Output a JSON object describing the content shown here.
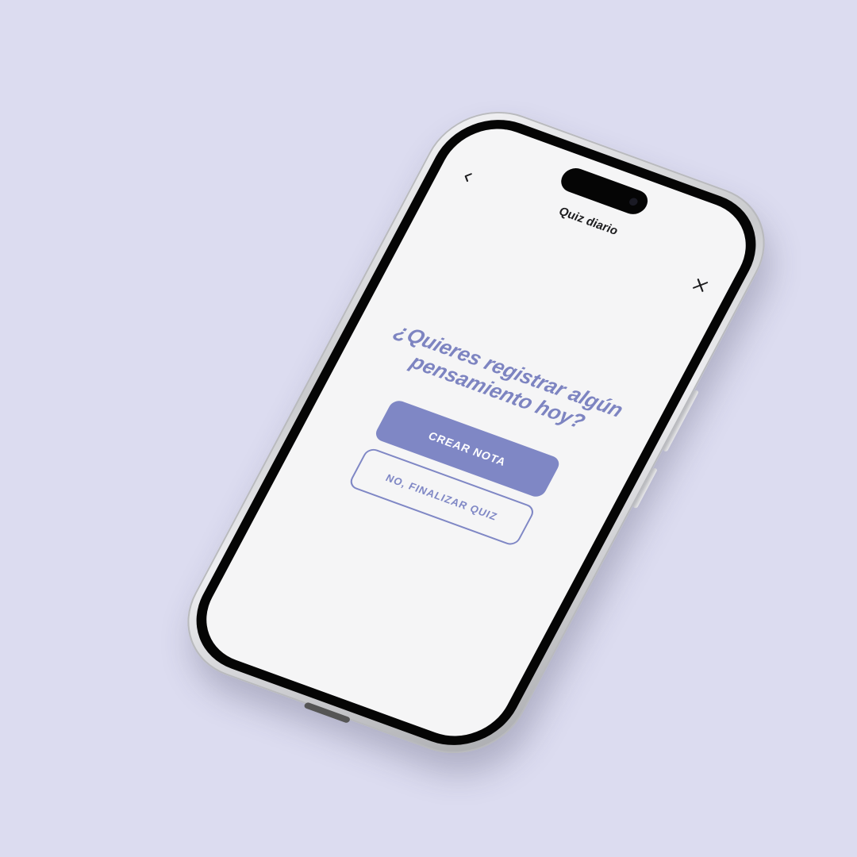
{
  "header": {
    "title": "Quiz diario",
    "back_icon": "chevron-left-icon",
    "close_icon": "close-icon"
  },
  "main": {
    "question": "¿Quieres registrar algún pensamiento hoy?",
    "primary_button": "CREAR NOTA",
    "secondary_button": "NO, FINALIZAR QUIZ"
  },
  "colors": {
    "background": "#dcdcf0",
    "accent": "#7f87c5",
    "screen": "#f5f5f6",
    "title_text": "#1c1c1e"
  }
}
